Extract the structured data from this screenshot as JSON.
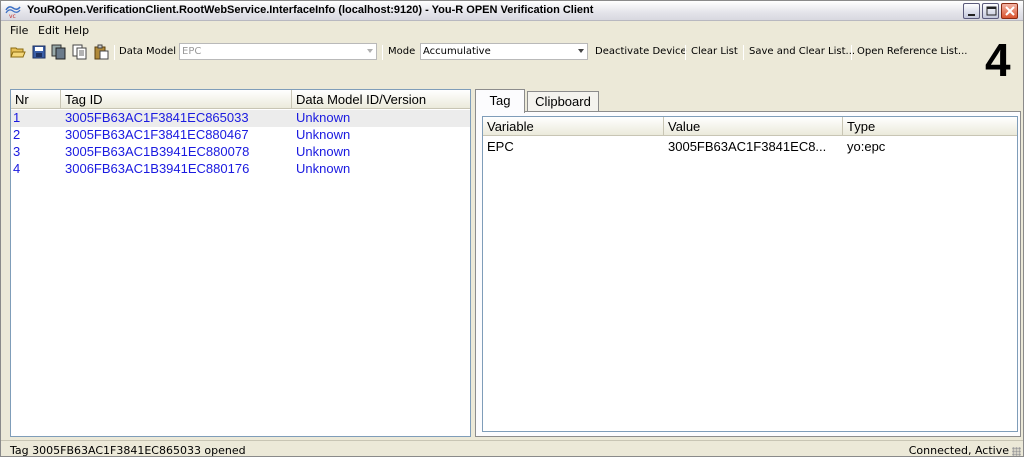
{
  "window": {
    "title": "YouROpen.VerificationClient.RootWebService.InterfaceInfo (localhost:9120)  -  You-R OPEN Verification Client"
  },
  "menu": {
    "items": [
      "File",
      "Edit",
      "Help"
    ]
  },
  "toolbar": {
    "icons": [
      "open-folder-icon",
      "save-icon",
      "copy-multi-icon",
      "copy-icon",
      "paste-icon"
    ],
    "data_model_label": "Data Model",
    "data_model_value": "EPC",
    "mode_label": "Mode",
    "mode_value": "Accumulative",
    "buttons": [
      "Deactivate Device",
      "Clear List",
      "Save and Clear List...",
      "Open Reference List..."
    ]
  },
  "counter": "4",
  "tag_list": {
    "columns": [
      "Nr",
      "Tag ID",
      "Data Model ID/Version"
    ],
    "rows": [
      {
        "nr": "1",
        "tag_id": "3005FB63AC1F3841EC865033",
        "model": "Unknown"
      },
      {
        "nr": "2",
        "tag_id": "3005FB63AC1F3841EC880467",
        "model": "Unknown"
      },
      {
        "nr": "3",
        "tag_id": "3005FB63AC1B3941EC880078",
        "model": "Unknown"
      },
      {
        "nr": "4",
        "tag_id": "3006FB63AC1B3941EC880176",
        "model": "Unknown"
      }
    ]
  },
  "detail": {
    "tabs": [
      "Tag",
      "Clipboard"
    ],
    "columns": [
      "Variable",
      "Value",
      "Type"
    ],
    "rows": [
      {
        "variable": "EPC",
        "value": "3005FB63AC1F3841EC8...",
        "type": "yo:epc"
      }
    ]
  },
  "status": {
    "left": "Tag 3005FB63AC1F3841EC865033 opened",
    "right": "Connected, Active"
  },
  "colors": {
    "link_text": "#1a1ae0",
    "close_button": "#d9542f"
  }
}
